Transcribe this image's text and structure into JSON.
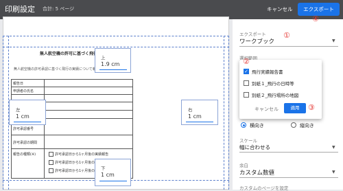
{
  "header": {
    "title": "印刷設定",
    "subtitle": "合計: 5 ページ",
    "cancel_label": "キャンセル",
    "export_label": "エクスポート"
  },
  "document": {
    "title": "無人航空機の許可に基づく飛行実",
    "intro": "無人航空機の許可承認に基づく飛行の実績について報告します。",
    "rows": [
      "報告日",
      "申請者の氏名",
      "",
      "",
      "",
      "許可承認番号",
      "許可承認の期間",
      "報告の種類(※)"
    ],
    "checkboxes": [
      "許可承認日から1ヶ月後の実績報告",
      "許可承認日から1ヶ月後の実績報告",
      "許可承認日から1ヶ月後の実績報告"
    ]
  },
  "margins": {
    "top": {
      "label": "上",
      "value": "1.9 cm"
    },
    "left": {
      "label": "左",
      "value": "1 cm"
    },
    "right": {
      "label": "右",
      "value": "1 cm"
    },
    "bottom": {
      "label": "下",
      "value": "1 cm"
    }
  },
  "panel": {
    "export_label": "エクスポート",
    "export_value": "ワークブック",
    "range_label": "選択範囲",
    "scale_label": "スケール",
    "scale_value": "幅に合わせる",
    "margin_label": "余白",
    "margin_value": "カスタム数値",
    "custom_label": "カスタムのページを設定",
    "orientation_landscape": "横向き",
    "orientation_portrait": "縦向き"
  },
  "popup": {
    "options": [
      {
        "label": "飛行実績報告書",
        "checked": true
      },
      {
        "label": "別紙１_飛行の日時等",
        "checked": false
      },
      {
        "label": "別紙２_飛行場所の地図",
        "checked": false
      }
    ],
    "cancel_label": "キャンセル",
    "apply_label": "適用"
  },
  "annotations": {
    "n1": "①",
    "n2": "②",
    "n3": "③",
    "n4": "④"
  },
  "colors": {
    "accent": "#1a73e8",
    "callout": "#e53935",
    "topbar": "#4a4b4e"
  }
}
